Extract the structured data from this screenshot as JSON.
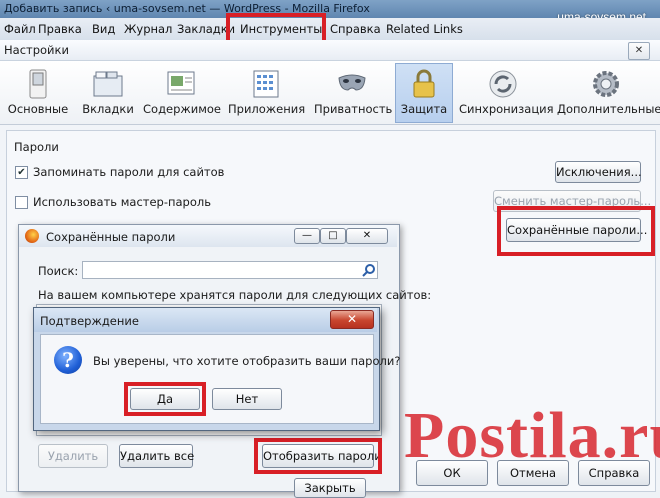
{
  "window": {
    "title": "Добавить запись ‹ uma-sovsem.net — WordPress - Mozilla Firefox",
    "watermark": "uma-sovsem.net"
  },
  "menubar": {
    "items": [
      "Файл",
      "Правка",
      "Вид",
      "Журнал",
      "Закладки",
      "Инструменты",
      "Справка",
      "Related Links"
    ],
    "highlighted": "Инструменты"
  },
  "settings": {
    "title": "Настройки",
    "close_label": "✕",
    "toolbar": [
      {
        "label": "Основные",
        "icon": "switch-icon"
      },
      {
        "label": "Вкладки",
        "icon": "tabs-icon"
      },
      {
        "label": "Содержимое",
        "icon": "content-icon"
      },
      {
        "label": "Приложения",
        "icon": "applications-icon"
      },
      {
        "label": "Приватность",
        "icon": "mask-icon"
      },
      {
        "label": "Защита",
        "icon": "padlock-icon",
        "selected": true
      },
      {
        "label": "Синхронизация",
        "icon": "sync-icon"
      },
      {
        "label": "Дополнительные",
        "icon": "gear-icon"
      }
    ],
    "passwords": {
      "group_label": "Пароли",
      "remember_label": "Запоминать пароли для сайтов",
      "remember_checked": true,
      "master_label": "Использовать мастер-пароль",
      "master_checked": false,
      "exceptions_button": "Исключения...",
      "change_master_button": "Сменить мастер-пароль...",
      "saved_button": "Сохранённые пароли..."
    },
    "footer": {
      "ok": "ОК",
      "cancel": "Отмена",
      "help": "Справка"
    }
  },
  "saved_passwords": {
    "title": "Сохранённые пароли",
    "search_label": "Поиск:",
    "search_value": "",
    "info_text": "На вашем компьютере хранятся пароли для следующих сайтов:",
    "delete_button": "Удалить",
    "delete_all_button": "Удалить все",
    "show_passwords_button": "Отобразить пароли",
    "close_button": "Закрыть",
    "window_buttons": {
      "minimize": "—",
      "maximize": "□",
      "close": "✕"
    }
  },
  "confirm": {
    "title": "Подтверждение",
    "message": "Вы уверены, что хотите отобразить ваши пароли?",
    "yes_button": "Да",
    "no_button": "Нет",
    "close_label": "✕"
  },
  "overlay": {
    "pinterest_text": "Postila.ru"
  },
  "colors": {
    "highlight_red": "#d81f26",
    "selected_tab": "#b7cfee",
    "titlebar": "#5f86b0"
  }
}
